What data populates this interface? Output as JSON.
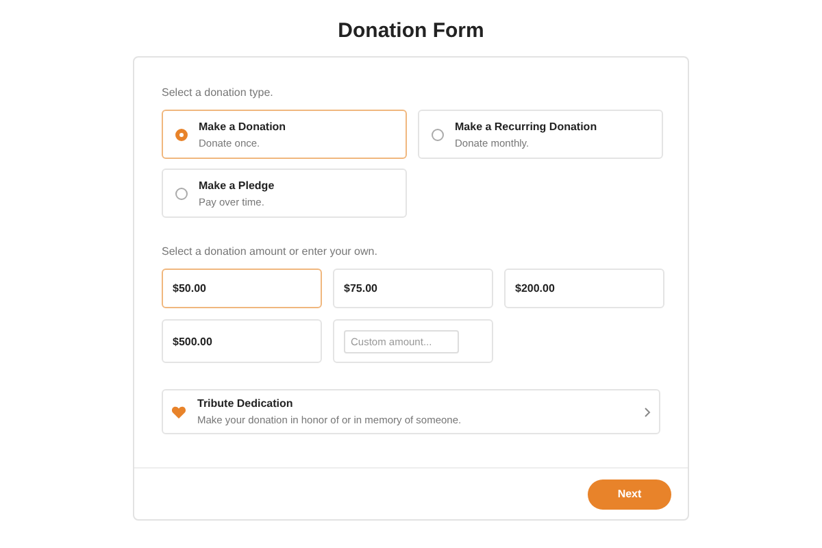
{
  "title": "Donation Form",
  "type_prompt": "Select a donation type.",
  "types": [
    {
      "label": "Make a Donation",
      "description": "Donate once.",
      "selected": true
    },
    {
      "label": "Make a Recurring Donation",
      "description": "Donate monthly.",
      "selected": false
    },
    {
      "label": "Make a Pledge",
      "description": "Pay over time.",
      "selected": false
    }
  ],
  "amount_prompt": "Select a donation amount or enter your own.",
  "amounts": [
    {
      "kind": "preset",
      "label": "$50.00",
      "selected": true
    },
    {
      "kind": "preset",
      "label": "$75.00",
      "selected": false
    },
    {
      "kind": "preset",
      "label": "$200.00",
      "selected": false
    },
    {
      "kind": "preset",
      "label": "$500.00",
      "selected": false
    },
    {
      "kind": "custom",
      "placeholder": "Custom amount..."
    }
  ],
  "tribute": {
    "title": "Tribute Dedication",
    "description": "Make your donation in honor of or in memory of someone."
  },
  "next_button": "Next"
}
